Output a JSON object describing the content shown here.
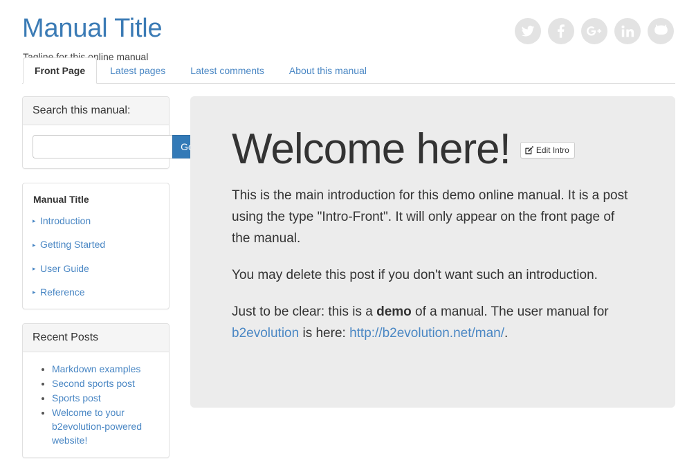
{
  "header": {
    "title": "Manual Title",
    "tagline": "Tagline for this online manual",
    "social": [
      {
        "name": "twitter-icon",
        "label": "Twitter"
      },
      {
        "name": "facebook-icon",
        "label": "Facebook"
      },
      {
        "name": "google-plus-icon",
        "label": "Google Plus"
      },
      {
        "name": "linkedin-icon",
        "label": "LinkedIn"
      },
      {
        "name": "github-icon",
        "label": "GitHub"
      }
    ]
  },
  "tabs": [
    {
      "label": "Front Page",
      "active": true
    },
    {
      "label": "Latest pages",
      "active": false
    },
    {
      "label": "Latest comments",
      "active": false
    },
    {
      "label": "About this manual",
      "active": false
    }
  ],
  "sidebar": {
    "search": {
      "heading": "Search this manual:",
      "value": "",
      "placeholder": "",
      "button_label": "Go"
    },
    "nav": {
      "title": "Manual Title",
      "bullet": "▸",
      "items": [
        {
          "label": "Introduction"
        },
        {
          "label": "Getting Started"
        },
        {
          "label": "User Guide"
        },
        {
          "label": "Reference"
        }
      ]
    },
    "recent_posts": {
      "heading": "Recent Posts",
      "items": [
        {
          "label": "Markdown examples"
        },
        {
          "label": "Second sports post"
        },
        {
          "label": "Sports post"
        },
        {
          "label": "Welcome to your b2evolution-powered website!"
        }
      ]
    }
  },
  "main": {
    "title": "Welcome here!",
    "edit_button": "Edit Intro",
    "paragraph_1": "This is the main introduction for this demo online manual. It is a post using the type \"Intro-Front\". It will only appear on the front page of the manual.",
    "paragraph_2": "You may delete this post if you don't want such an introduction.",
    "paragraph_3_a": "Just to be clear: this is a ",
    "paragraph_3_strong": "demo",
    "paragraph_3_b": " of a manual. The user manual for ",
    "paragraph_3_link1": "b2evolution",
    "paragraph_3_c": " is here: ",
    "paragraph_3_link2": "http://b2evolution.net/man/",
    "paragraph_3_d": "."
  },
  "colors": {
    "brand_blue": "#3b7bb5",
    "link_blue": "#4a87c4",
    "button_blue": "#337ab7",
    "card_grey": "#ececec",
    "panel_header_grey": "#f5f5f5",
    "text_dark": "#333333",
    "social_grey": "#e3e3e3"
  }
}
